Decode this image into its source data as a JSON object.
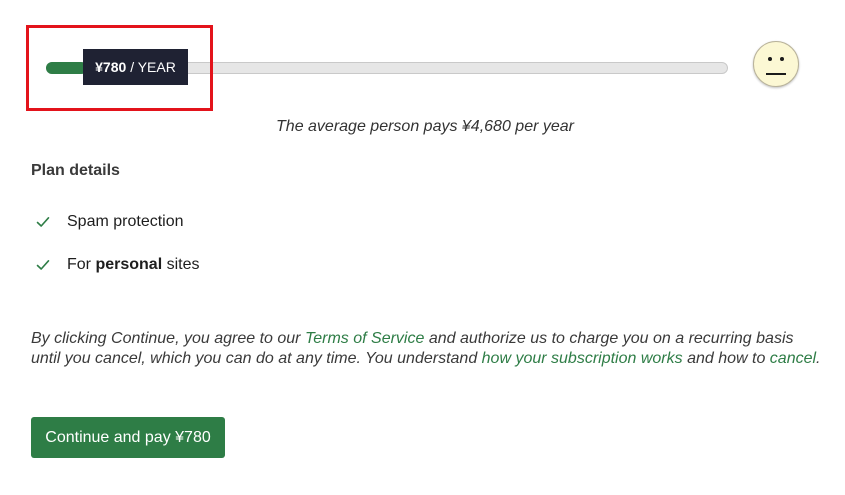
{
  "slider": {
    "price": "¥780",
    "period": "/ YEAR",
    "fill_fraction": 0.06
  },
  "face": {
    "icon": "neutral-face-icon"
  },
  "average_note": "The average person pays ¥4,680 per year",
  "plan": {
    "heading": "Plan details",
    "features": [
      {
        "icon": "check-icon",
        "text": "Spam protection"
      },
      {
        "icon": "check-icon",
        "pre": "For ",
        "bold": "personal",
        "post": " sites"
      }
    ]
  },
  "terms": {
    "part1": "By clicking Continue, you agree to our ",
    "link_tos": "Terms of Service",
    "part2": " and authorize us to charge you on a recurring basis until you cancel, which you can do at any time. You understand ",
    "link_how": "how your subscription works",
    "part3": " and how to ",
    "link_cancel": "cancel",
    "part4": "."
  },
  "continue_button": {
    "label": "Continue and pay ¥780"
  },
  "colors": {
    "accent": "#2e7d46",
    "handle": "#1f2233",
    "highlight": "#e3131b"
  }
}
